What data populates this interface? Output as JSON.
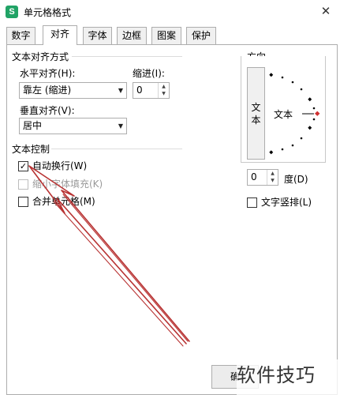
{
  "window": {
    "title": "单元格格式",
    "app_icon": "S",
    "close_glyph": "✕"
  },
  "tabs": [
    {
      "label": "数字",
      "active": false
    },
    {
      "label": "对齐",
      "active": true
    },
    {
      "label": "字体",
      "active": false
    },
    {
      "label": "边框",
      "active": false
    },
    {
      "label": "图案",
      "active": false
    },
    {
      "label": "保护",
      "active": false
    }
  ],
  "alignment": {
    "group_label": "文本对齐方式",
    "horizontal_label": "水平对齐(H):",
    "horizontal_value": "靠左 (缩进)",
    "indent_label": "缩进(I):",
    "indent_value": "0",
    "vertical_label": "垂直对齐(V):",
    "vertical_value": "居中"
  },
  "text_control": {
    "group_label": "文本控制",
    "wrap_text": {
      "label": "自动换行(W)",
      "checked": true,
      "enabled": true
    },
    "shrink_to_fit": {
      "label": "缩小字体填充(K)",
      "checked": false,
      "enabled": false
    },
    "merge_cells": {
      "label": "合并单元格(M)",
      "checked": false,
      "enabled": true
    }
  },
  "orientation": {
    "group_label": "方向",
    "vertical_text": "文本",
    "dial_text": "文本",
    "degree_value": "0",
    "degree_label": "度(D)",
    "vertical_stack": {
      "label": "文字竖排(L)",
      "checked": false
    }
  },
  "buttons": {
    "ok_label": "确"
  },
  "watermark": {
    "text": "软件技巧"
  },
  "colors": {
    "annotation_arrow": "#b83232",
    "dial_pointer": "#d03030"
  },
  "icons": [
    "spreadsheet-app-icon",
    "close-icon",
    "dropdown-arrow-icon",
    "spin-up-icon",
    "spin-down-icon",
    "checkmark-icon",
    "annotation-arrow"
  ]
}
